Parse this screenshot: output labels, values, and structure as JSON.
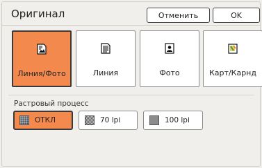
{
  "header": {
    "title": "Оригинал",
    "cancel_label": "Отменить",
    "ok_label": "OK"
  },
  "modes": [
    {
      "label": "Линия/Фото",
      "icon": "text-photo-icon",
      "selected": true
    },
    {
      "label": "Линия",
      "icon": "text-document-icon",
      "selected": false
    },
    {
      "label": "Фото",
      "icon": "photo-portrait-icon",
      "selected": false
    },
    {
      "label": "Карт/Карнд",
      "icon": "map-pencil-icon",
      "selected": false
    }
  ],
  "screening": {
    "label": "Растровый процесс",
    "options": [
      {
        "label": "ОТКЛ",
        "icon": "screen-off-swatch-icon",
        "selected": true
      },
      {
        "label": "70 lpi",
        "icon": "screen-70-swatch-icon",
        "selected": false
      },
      {
        "label": "100 lpi",
        "icon": "screen-100-swatch-icon",
        "selected": false
      }
    ]
  },
  "colors": {
    "accent": "#f3894c",
    "background": "#f1efeb",
    "button": "#ffffff"
  }
}
